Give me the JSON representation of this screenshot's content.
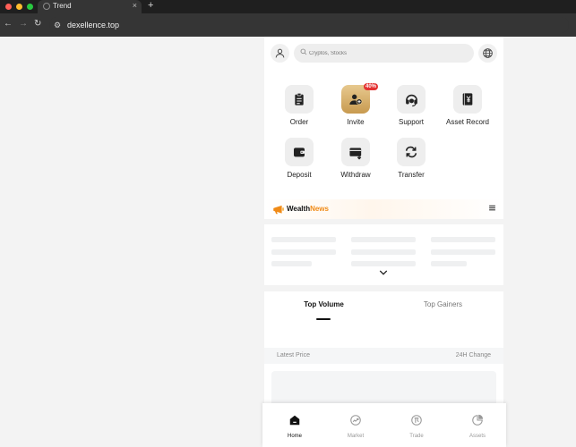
{
  "browser": {
    "tab_title": "Trend",
    "tab_close": "×",
    "new_tab": "+",
    "back": "←",
    "forward": "→",
    "reload": "↻",
    "site_info": "⚙",
    "url": "dexellence.top"
  },
  "header": {
    "search_placeholder": "Cryptos, Stocks",
    "avatar_icon": "user-icon",
    "language_icon": "globe-icon"
  },
  "quick_actions": [
    {
      "label": "Order",
      "icon": "clipboard-icon"
    },
    {
      "label": "Invite",
      "icon": "add-user-icon",
      "badge": "40%"
    },
    {
      "label": "Support",
      "icon": "headset-icon"
    },
    {
      "label": "Asset Record",
      "icon": "yen-book-icon"
    },
    {
      "label": "Deposit",
      "icon": "wallet-icon"
    },
    {
      "label": "Withdraw",
      "icon": "card-icon"
    },
    {
      "label": "Transfer",
      "icon": "swap-icon"
    }
  ],
  "news": {
    "brand_main": "Wealth",
    "brand_accent": "News",
    "accent_color": "#f08a16"
  },
  "market_tabs": [
    {
      "label": "Top Volume",
      "active": true
    },
    {
      "label": "Top Gainers",
      "active": false
    }
  ],
  "price_table": {
    "col_left": "Latest Price",
    "col_right": "24H Change"
  },
  "bottom_nav": [
    {
      "label": "Home",
      "icon": "home-icon",
      "active": true
    },
    {
      "label": "Market",
      "icon": "market-icon",
      "active": false
    },
    {
      "label": "Trade",
      "icon": "trade-icon",
      "active": false
    },
    {
      "label": "Assets",
      "icon": "pie-chart-icon",
      "active": false
    }
  ]
}
